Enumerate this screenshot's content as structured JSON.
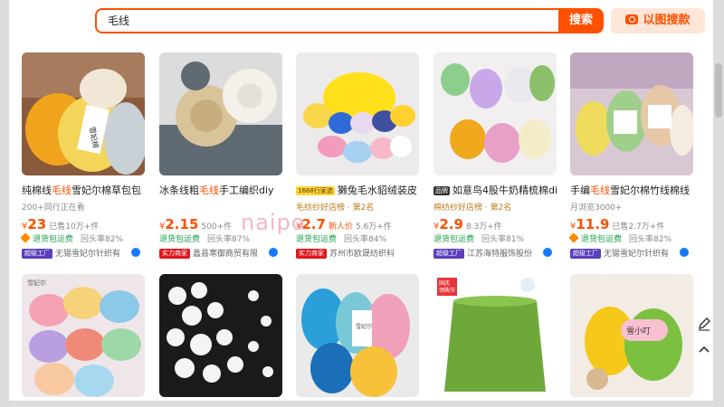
{
  "search": {
    "query": "毛线",
    "button_label": "搜索",
    "image_search_label": "以图搜款"
  },
  "watermark": "naipo",
  "products": [
    {
      "title_pre": "纯棉线",
      "title_hl": "毛线",
      "title_post": "雪妃尔棉草包包",
      "tag": "",
      "sub": "200+同行正在看",
      "price": "23",
      "sold": "已售10万+件",
      "return": "退货包运费",
      "return_rate": "回头率82%",
      "badge": "超级工厂",
      "shop": "无锡雪妃尔针织有"
    },
    {
      "title_pre": "冰条线粗",
      "title_hl": "毛线",
      "title_post": "手工编织diy",
      "tag": "",
      "sub": "",
      "price": "2.15",
      "sold": "500+件",
      "return": "退货包运费",
      "return_rate": "回头率87%",
      "badge": "实力商家",
      "shop": "蠡县寒御商贸有限"
    },
    {
      "title_pre": "",
      "title_hl": "",
      "title_post": "獭兔毛水貂绒装皮",
      "tag": "1688行家选",
      "sub": "毛纺纱好店榜 · 第2名",
      "price": "2.7",
      "sold": "5.6万+件",
      "new_price": "新人价",
      "return": "退货包运费",
      "return_rate": "回头率84%",
      "badge": "实力商家",
      "shop": "苏州市欧晟纺织科"
    },
    {
      "title_pre": "",
      "title_hl": "",
      "title_post": "如意鸟4股牛奶精梳棉di",
      "tag": "品牌",
      "sub": "棉纺纱好店榜 · 第2名",
      "price": "2.9",
      "sold": "8.3万+件",
      "return": "退货包运费",
      "return_rate": "回头率81%",
      "badge": "超级工厂",
      "shop": "江苏海特服饰股份"
    },
    {
      "title_pre": "手编",
      "title_hl": "毛线",
      "title_post": "雪妃尔棉竹线棉线",
      "tag": "",
      "sub": "月浏览3000+",
      "price": "11.9",
      "sold": "已售2.7万+件",
      "return": "退货包运费",
      "return_rate": "回头率82%",
      "badge": "超级工厂",
      "shop": "无锡雪妃尔针织有"
    }
  ],
  "image_text": {
    "yarn_label": "雪妃棉",
    "row2_brand": "雪妃尔",
    "row2_label_3": "雪妃尔",
    "row2_tag_4a": "国庆",
    "row2_tag_4b": "领购节",
    "row2_label_5": "雪小叮"
  },
  "colors": {
    "accent": "#ff5000",
    "return_green": "#1aa04b",
    "badge_purple": "#5b3fbf",
    "badge_red": "#e0161b"
  }
}
